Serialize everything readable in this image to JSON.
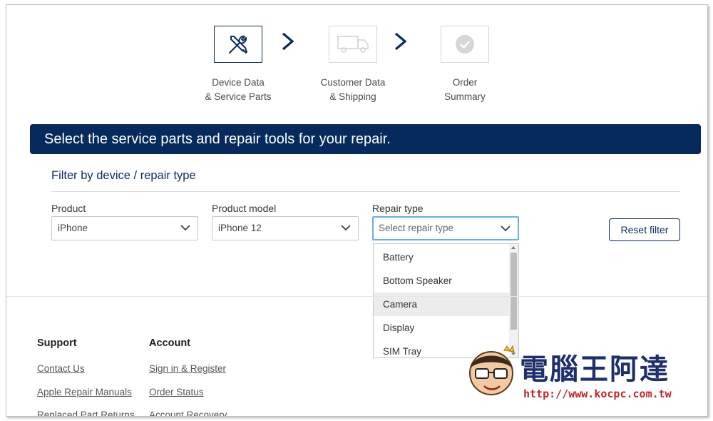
{
  "stepper": {
    "steps": [
      {
        "line1": "Device Data",
        "line2": "& Service Parts",
        "icon": "wrench-screwdriver-icon",
        "state": "active"
      },
      {
        "line1": "Customer Data",
        "line2": "& Shipping",
        "icon": "truck-icon",
        "state": "inactive"
      },
      {
        "line1": "Order",
        "line2": "Summary",
        "icon": "check-circle-icon",
        "state": "inactive"
      }
    ]
  },
  "banner": {
    "text": "Select the service parts and repair tools for your repair."
  },
  "filter": {
    "title": "Filter by device / repair type",
    "product": {
      "label": "Product",
      "value": "iPhone"
    },
    "model": {
      "label": "Product model",
      "value": "iPhone 12"
    },
    "repair_type": {
      "label": "Repair type",
      "placeholder": "Select repair type"
    },
    "reset_label": "Reset filter"
  },
  "dropdown": {
    "options": [
      "Battery",
      "Bottom Speaker",
      "Camera",
      "Display",
      "SIM Tray"
    ],
    "highlighted": "Camera"
  },
  "footer": {
    "support": {
      "heading": "Support",
      "links": [
        "Contact Us",
        "Apple Repair Manuals",
        "Replaced Part Returns"
      ]
    },
    "account": {
      "heading": "Account",
      "links": [
        "Sign in & Register",
        "Order Status",
        "Account Recovery"
      ]
    }
  },
  "watermark": {
    "brand": "電腦王阿達",
    "url": "http://www.kocpc.com.tw"
  },
  "colors": {
    "primary": "#062a5c",
    "focus": "#6aaedf",
    "watermark_red": "#c0282d"
  }
}
